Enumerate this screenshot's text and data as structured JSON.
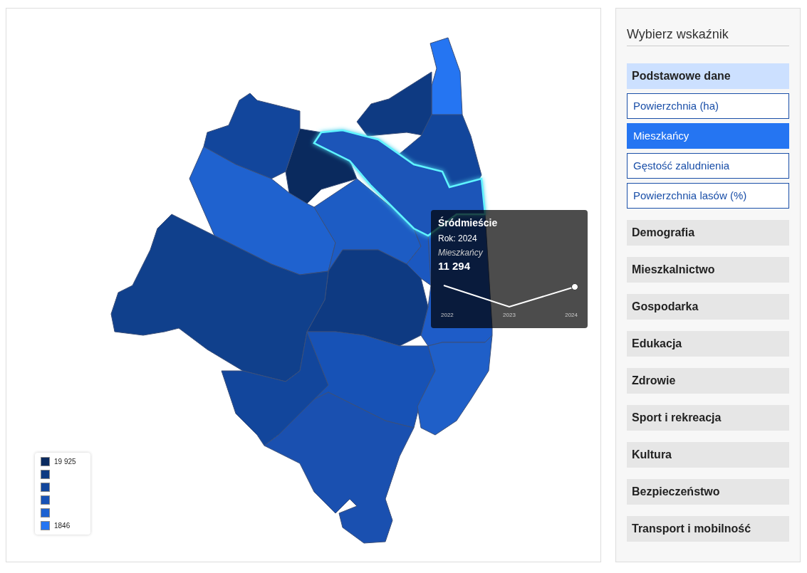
{
  "tooltip": {
    "title": "Śródmieście",
    "year": "Rok: 2024",
    "indicator": "Mieszkańcy",
    "value": "11 294",
    "years": [
      "2022",
      "2023",
      "2024"
    ]
  },
  "legend": [
    {
      "color": "#0a2a5e",
      "label": "19 925"
    },
    {
      "color": "#0e3a82"
    },
    {
      "color": "#12469c"
    },
    {
      "color": "#1752b6"
    },
    {
      "color": "#1d62d2"
    },
    {
      "color": "#2575f2",
      "label": "1846"
    }
  ],
  "sidebar": {
    "title": "Wybierz wskaźnik",
    "groups": [
      {
        "title": "Podstawowe dane",
        "expanded": true,
        "items": [
          {
            "label": "Powierzchnia (ha)",
            "selected": false
          },
          {
            "label": "Mieszkańcy",
            "selected": true
          },
          {
            "label": "Gęstość zaludnienia",
            "selected": false
          },
          {
            "label": "Powierzchnia lasów (%)",
            "selected": false
          }
        ]
      },
      {
        "title": "Demografia",
        "expanded": false
      },
      {
        "title": "Mieszkalnictwo",
        "expanded": false
      },
      {
        "title": "Gospodarka",
        "expanded": false
      },
      {
        "title": "Edukacja",
        "expanded": false
      },
      {
        "title": "Zdrowie",
        "expanded": false
      },
      {
        "title": "Sport i rekreacja",
        "expanded": false
      },
      {
        "title": "Kultura",
        "expanded": false
      },
      {
        "title": "Bezpieczeństwo",
        "expanded": false
      },
      {
        "title": "Transport i mobilność",
        "expanded": false
      }
    ]
  }
}
